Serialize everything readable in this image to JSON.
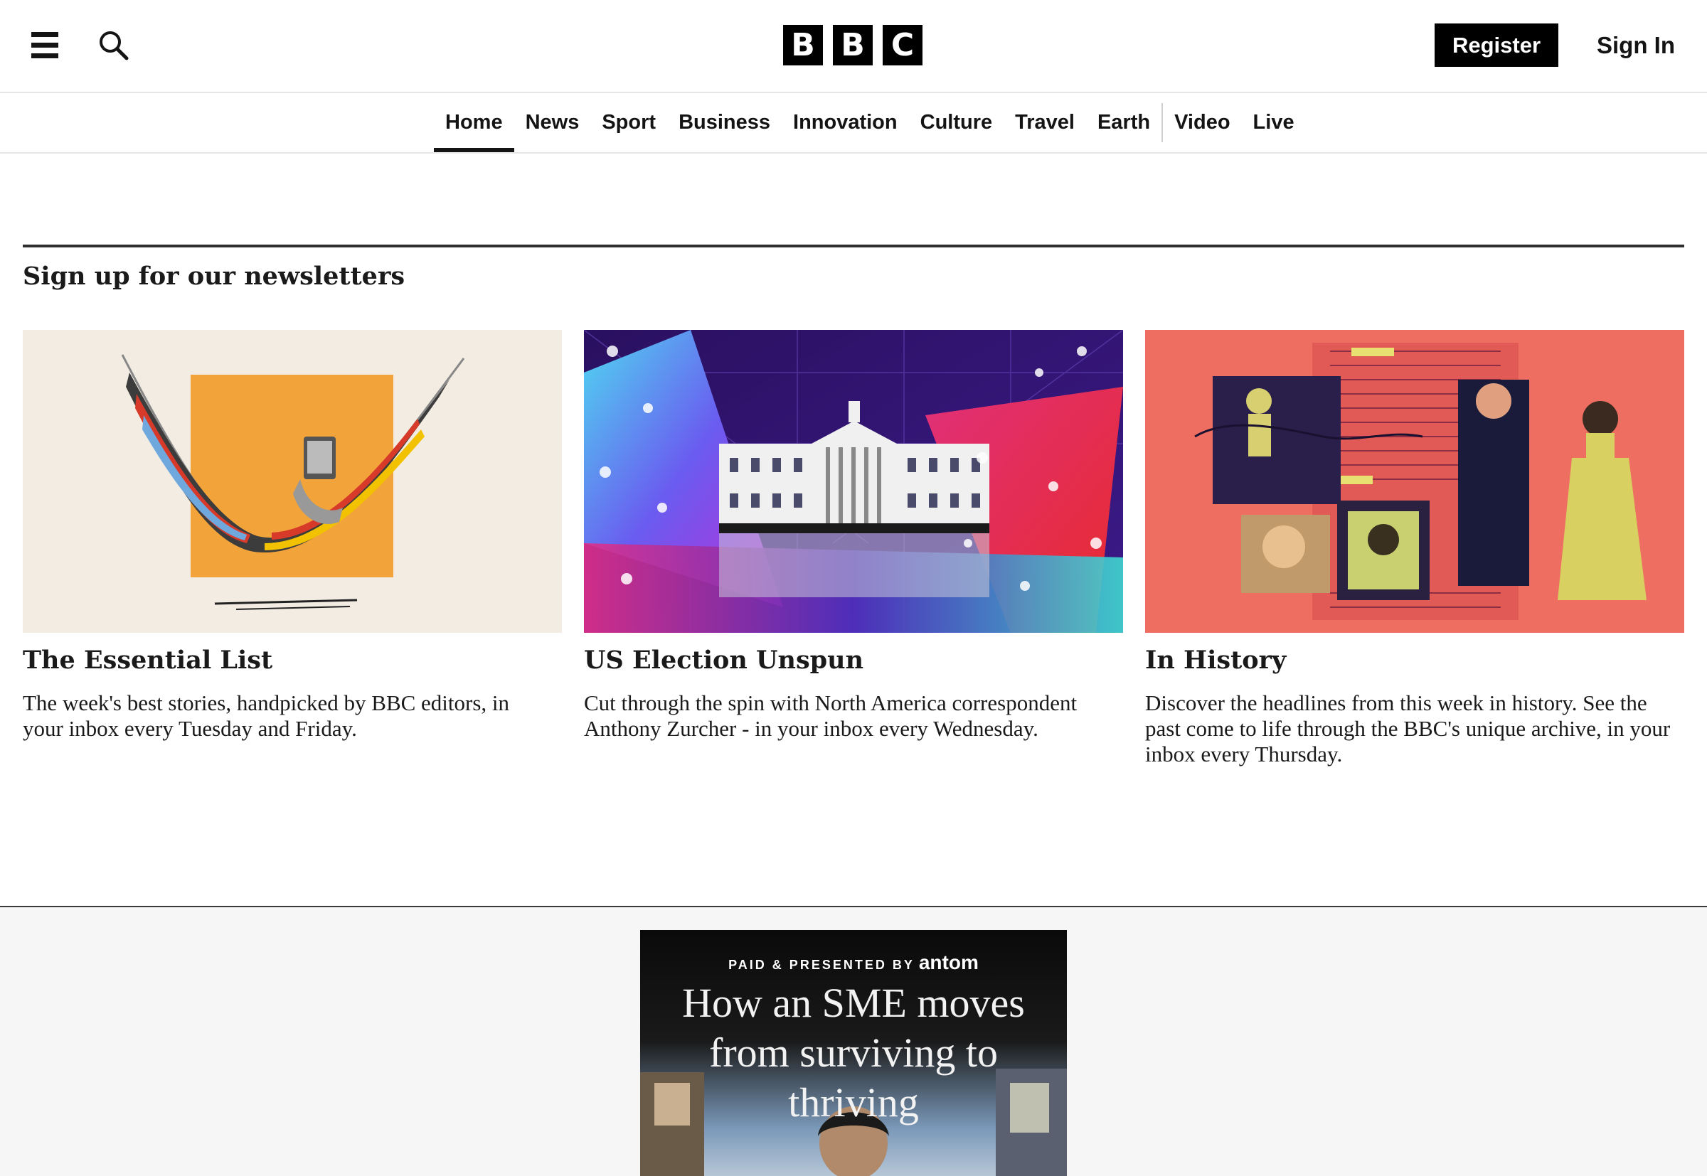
{
  "header": {
    "logo_letters": [
      "B",
      "B",
      "C"
    ],
    "register_label": "Register",
    "signin_label": "Sign In"
  },
  "nav": {
    "items": [
      {
        "label": "Home",
        "active": true
      },
      {
        "label": "News"
      },
      {
        "label": "Sport"
      },
      {
        "label": "Business"
      },
      {
        "label": "Innovation"
      },
      {
        "label": "Culture"
      },
      {
        "label": "Travel"
      },
      {
        "label": "Earth"
      },
      {
        "label": "Video"
      },
      {
        "label": "Live"
      }
    ]
  },
  "newsletters": {
    "title": "Sign up for our newsletters",
    "cards": [
      {
        "title": "The Essential List",
        "description": "The week's best stories, handpicked by BBC editors, in your inbox every Tuesday and Friday."
      },
      {
        "title": "US Election Unspun",
        "description": "Cut through the spin with North America correspondent Anthony Zurcher - in your inbox every Wednesday."
      },
      {
        "title": "In History",
        "description": "Discover the headlines from this week in history. See the past come to life through the BBC's unique archive, in your inbox every Thursday."
      }
    ]
  },
  "ad": {
    "sponsor_label": "PAID & PRESENTED BY",
    "brand": "antom",
    "headline": "How an SME moves from surviving to thriving"
  },
  "colors": {
    "brand_black": "#000000",
    "rule": "#2f2f2f",
    "ad_background": "#f6f6f6"
  }
}
